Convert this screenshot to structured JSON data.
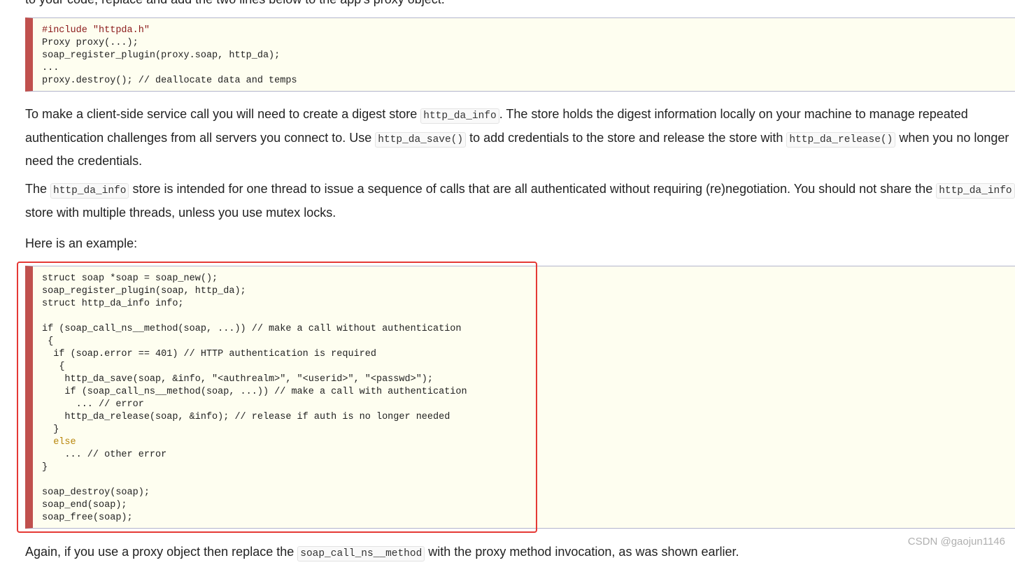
{
  "top_text": "to your code, replace and add the two lines below to the app's proxy object.",
  "code_block_1": {
    "lines": [
      "#include \"httpda.h\"",
      "Proxy proxy(...);",
      "soap_register_plugin(proxy.soap, http_da);",
      "...",
      "proxy.destroy(); // deallocate data and temps"
    ]
  },
  "para1": {
    "t1": "To make a client-side service call you will need to create a digest store ",
    "c1": "http_da_info",
    "t2": ". The store holds the digest information locally on your machine to manage repeated authentication challenges from all servers you connect to. Use ",
    "c2": "http_da_save()",
    "t3": " to add credentials to the store and release the store with ",
    "c3": "http_da_release()",
    "t4": " when you no longer need the credentials."
  },
  "para2": {
    "t1": "The ",
    "c1": "http_da_info",
    "t2": " store is intended for one thread to issue a sequence of calls that are all authenticated without requiring (re)negotiation. You should not share the ",
    "c2": "http_da_info",
    "t3": " store with multiple threads, unless you use mutex locks."
  },
  "para3": "Here is an example:",
  "code_block_2": {
    "line1": "struct soap *soap = soap_new();",
    "line2": "soap_register_plugin(soap, http_da);",
    "line3": "struct http_da_info info;",
    "line5": "if (soap_call_ns__method(soap, ...)) // make a call without authentication",
    "line6": "{",
    "line7": "if (soap.error == 401) // HTTP authentication is required",
    "line8": "{",
    "line9": "http_da_save(soap, &info, \"<authrealm>\", \"<userid>\", \"<passwd>\");",
    "line10": "if (soap_call_ns__method(soap, ...)) // make a call with authentication",
    "line11": "... // error",
    "line12": "http_da_release(soap, &info); // release if auth is no longer needed",
    "line13": "}",
    "line14": "else",
    "line15": "... // other error",
    "line16": "}",
    "line18": "soap_destroy(soap);",
    "line19": "soap_end(soap);",
    "line20": "soap_free(soap);"
  },
  "para4": {
    "t1": "Again, if you use a proxy object then replace the ",
    "c1": "soap_call_ns__method",
    "t2": " with the proxy method invocation, as was shown earlier."
  },
  "watermark": "CSDN @gaojun1146",
  "colors": {
    "code_bar": "#c0504d",
    "code_bg": "#fefef0",
    "highlight_frame": "#e53935",
    "keyword": "#b8860b",
    "type": "#3c5ca8",
    "comment": "#8b1a1a"
  }
}
